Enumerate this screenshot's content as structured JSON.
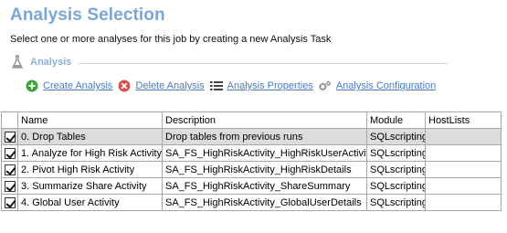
{
  "header": {
    "title": "Analysis Selection",
    "subtitle": "Select one or more analyses for this job by creating a new Analysis Task"
  },
  "section": {
    "label": "Analysis",
    "icon": "flask-icon"
  },
  "toolbar": {
    "create_label": "Create Analysis",
    "delete_label": "Delete Analysis",
    "properties_label": "Analysis Properties",
    "configuration_label": "Analysis Configuration"
  },
  "table": {
    "columns": [
      "Name",
      "Description",
      "Module",
      "HostLists"
    ],
    "rows": [
      {
        "name": "0. Drop Tables",
        "description": "Drop tables from previous runs",
        "module": "SQLscripting",
        "hostlists": ""
      },
      {
        "name": "1. Analyze for High Risk Activity",
        "description": "SA_FS_HighRiskActivity_HighRiskUserActivity",
        "module": "SQLscripting",
        "hostlists": ""
      },
      {
        "name": "2. Pivot High Risk Activity",
        "description": "SA_FS_HighRiskActivity_HighRiskDetails",
        "module": "SQLscripting",
        "hostlists": ""
      },
      {
        "name": "3. Summarize Share Activity",
        "description": "SA_FS_HighRiskActivity_ShareSummary",
        "module": "SQLscripting",
        "hostlists": ""
      },
      {
        "name": "4. Global User Activity",
        "description": "SA_FS_HighRiskActivity_GlobalUserDetails",
        "module": "SQLscripting",
        "hostlists": ""
      }
    ]
  },
  "colors": {
    "title": "#7aa6d6",
    "link": "#4a7cc0",
    "create_icon": "#3aa53a",
    "delete_icon": "#d9534f",
    "selected_row": "#dcdcdc"
  }
}
